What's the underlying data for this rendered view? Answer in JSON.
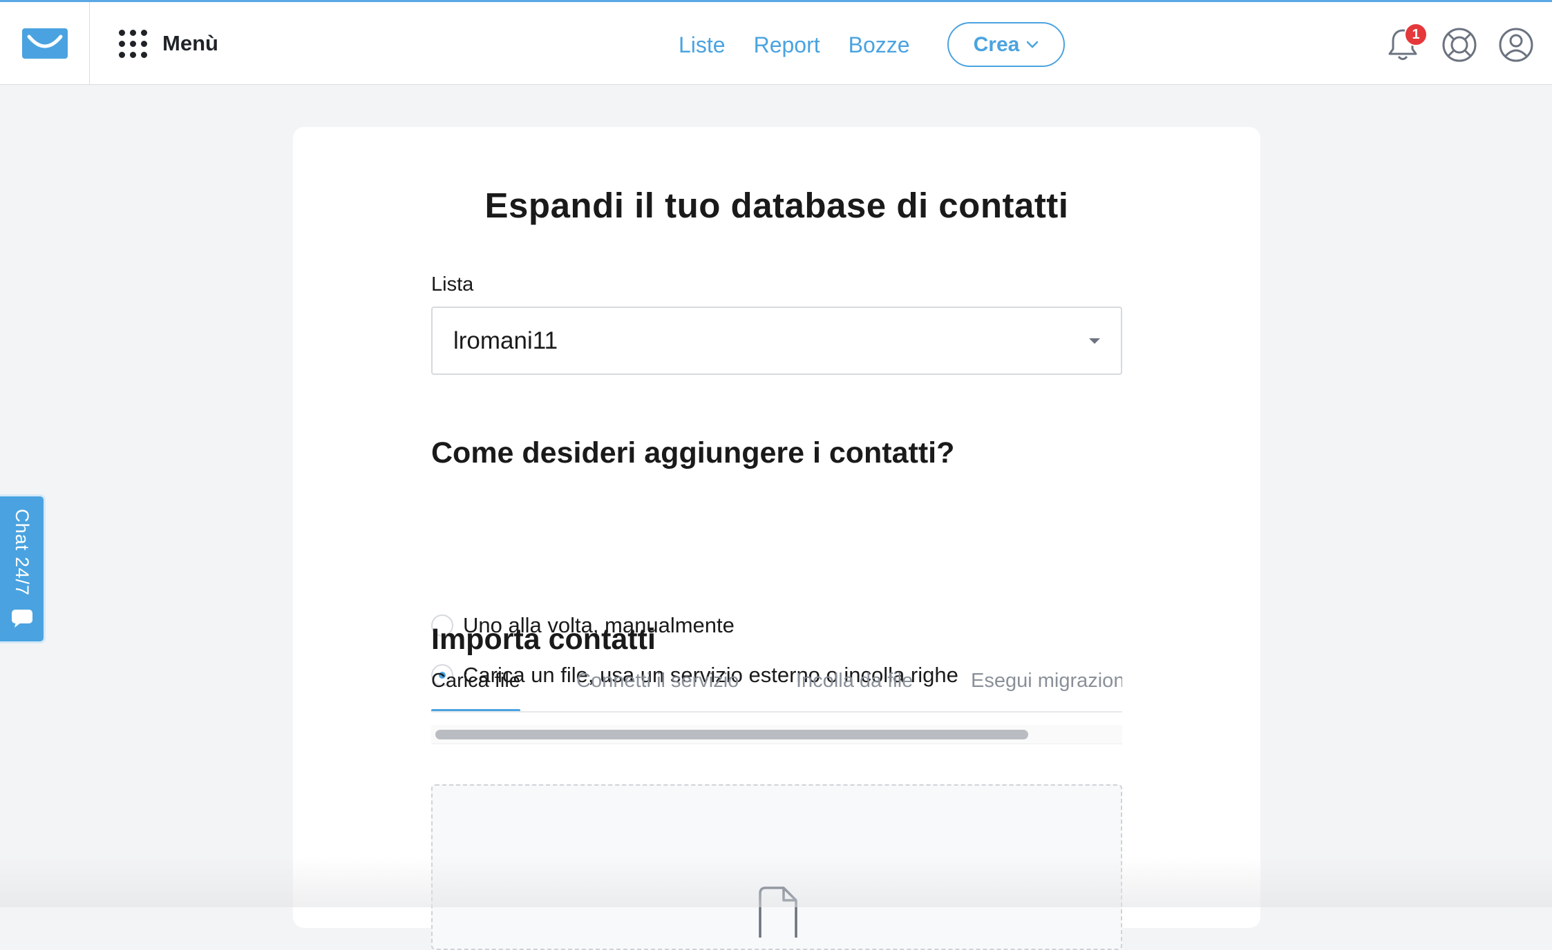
{
  "header": {
    "menu_label": "Menù",
    "nav": [
      {
        "label": "Liste"
      },
      {
        "label": "Report"
      },
      {
        "label": "Bozze"
      }
    ],
    "create_label": "Crea",
    "notification_count": "1",
    "icons": [
      "envelope-logo-icon",
      "grid-menu-icon",
      "chevron-down-icon",
      "bell-icon",
      "lifebuoy-help-icon",
      "user-account-icon"
    ],
    "accent_color": "#4aa3e0"
  },
  "chat": {
    "label": "Chat 24/7",
    "icon": "speech-bubble-icon"
  },
  "main": {
    "title": "Espandi il tuo database di contatti",
    "list_field": {
      "label": "Lista",
      "value": "lromani11"
    },
    "question": "Come desideri aggiungere i contatti?",
    "options": [
      {
        "label": "Uno alla volta, manualmente",
        "checked": false
      },
      {
        "label": "Carica un file, usa un servizio esterno o incolla righe",
        "checked": true
      }
    ],
    "import_title": "Importa contatti",
    "tabs": [
      {
        "label": "Carica file",
        "active": true
      },
      {
        "label": "Connetti il servizio",
        "active": false
      },
      {
        "label": "Incolla da file",
        "active": false
      },
      {
        "label": "Esegui migrazion",
        "active": false
      }
    ],
    "dropzone_icon": "file-icon"
  }
}
